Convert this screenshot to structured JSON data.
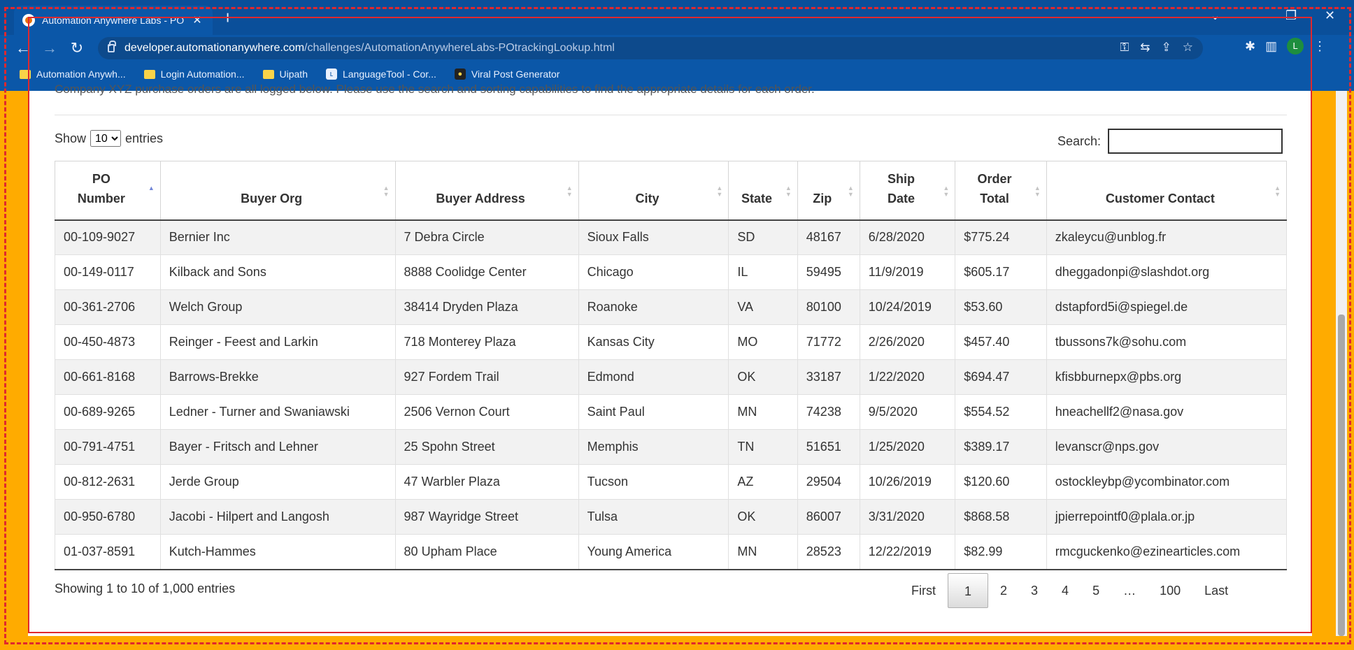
{
  "browser": {
    "tab_title": "Automation Anywhere Labs - PO",
    "url_host": "developer.automationanywhere.com",
    "url_path": "/challenges/AutomationAnywhereLabs-POtrackingLookup.html",
    "profile_initial": "L",
    "bookmarks": [
      {
        "label": "Automation Anywh...",
        "icon": "folder-icon"
      },
      {
        "label": "Login Automation...",
        "icon": "folder-icon"
      },
      {
        "label": "Uipath",
        "icon": "folder-icon"
      },
      {
        "label": "LanguageTool - Cor...",
        "icon": "languagetool-icon"
      },
      {
        "label": "Viral Post Generator",
        "icon": "app-icon"
      }
    ]
  },
  "page": {
    "intro": "Company XYZ purchase orders are all logged below. Please use the search and sorting capabilities to find the appropriate details for each order.",
    "show_label": "Show",
    "entries_label": "entries",
    "page_length": "10",
    "search_label": "Search:",
    "search_value": ""
  },
  "table": {
    "headers": [
      {
        "line1": "PO",
        "line2": "Number",
        "sort": "asc"
      },
      {
        "line1": "",
        "line2": "Buyer Org",
        "sort": "both"
      },
      {
        "line1": "",
        "line2": "Buyer Address",
        "sort": "both"
      },
      {
        "line1": "",
        "line2": "City",
        "sort": "both"
      },
      {
        "line1": "",
        "line2": "State",
        "sort": "both"
      },
      {
        "line1": "",
        "line2": "Zip",
        "sort": "both"
      },
      {
        "line1": "Ship",
        "line2": "Date",
        "sort": "both"
      },
      {
        "line1": "Order",
        "line2": "Total",
        "sort": "both"
      },
      {
        "line1": "",
        "line2": "Customer Contact",
        "sort": "both"
      }
    ],
    "rows": [
      [
        "00-109-9027",
        "Bernier Inc",
        "7 Debra Circle",
        "Sioux Falls",
        "SD",
        "48167",
        "6/28/2020",
        "$775.24",
        "zkaleycu@unblog.fr"
      ],
      [
        "00-149-0117",
        "Kilback and Sons",
        "8888 Coolidge Center",
        "Chicago",
        "IL",
        "59495",
        "11/9/2019",
        "$605.17",
        "dheggadonpi@slashdot.org"
      ],
      [
        "00-361-2706",
        "Welch Group",
        "38414 Dryden Plaza",
        "Roanoke",
        "VA",
        "80100",
        "10/24/2019",
        "$53.60",
        "dstapford5i@spiegel.de"
      ],
      [
        "00-450-4873",
        "Reinger - Feest and Larkin",
        "718 Monterey Plaza",
        "Kansas City",
        "MO",
        "71772",
        "2/26/2020",
        "$457.40",
        "tbussons7k@sohu.com"
      ],
      [
        "00-661-8168",
        "Barrows-Brekke",
        "927 Fordem Trail",
        "Edmond",
        "OK",
        "33187",
        "1/22/2020",
        "$694.47",
        "kfisbburnepx@pbs.org"
      ],
      [
        "00-689-9265",
        "Ledner - Turner and Swaniawski",
        "2506 Vernon Court",
        "Saint Paul",
        "MN",
        "74238",
        "9/5/2020",
        "$554.52",
        "hneachellf2@nasa.gov"
      ],
      [
        "00-791-4751",
        "Bayer - Fritsch and Lehner",
        "25 Spohn Street",
        "Memphis",
        "TN",
        "51651",
        "1/25/2020",
        "$389.17",
        "levanscr@nps.gov"
      ],
      [
        "00-812-2631",
        "Jerde Group",
        "47 Warbler Plaza",
        "Tucson",
        "AZ",
        "29504",
        "10/26/2019",
        "$120.60",
        "ostockleybp@ycombinator.com"
      ],
      [
        "00-950-6780",
        "Jacobi - Hilpert and Langosh",
        "987 Wayridge Street",
        "Tulsa",
        "OK",
        "86007",
        "3/31/2020",
        "$868.58",
        "jpierrepointf0@plala.or.jp"
      ],
      [
        "01-037-8591",
        "Kutch-Hammes",
        "80 Upham Place",
        "Young America",
        "MN",
        "28523",
        "12/22/2019",
        "$82.99",
        "rmcguckenko@ezinearticles.com"
      ]
    ]
  },
  "footer": {
    "info": "Showing 1 to 10 of 1,000 entries",
    "pagination": [
      {
        "label": "First",
        "current": false
      },
      {
        "label": "1",
        "current": true
      },
      {
        "label": "2",
        "current": false
      },
      {
        "label": "3",
        "current": false
      },
      {
        "label": "4",
        "current": false
      },
      {
        "label": "5",
        "current": false
      },
      {
        "label": "…",
        "current": false
      },
      {
        "label": "100",
        "current": false
      },
      {
        "label": "Last",
        "current": false
      }
    ]
  }
}
